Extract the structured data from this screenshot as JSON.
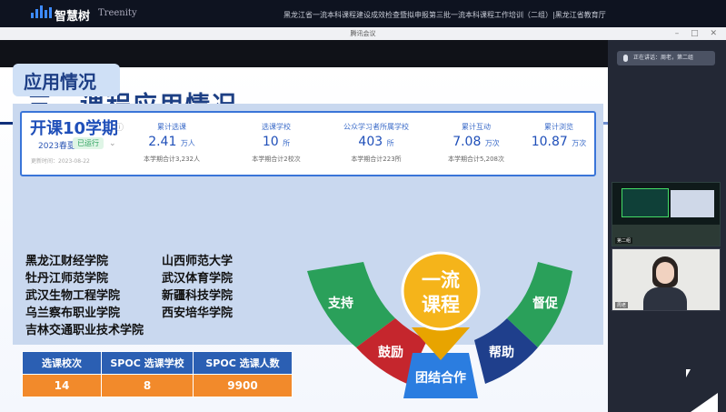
{
  "topbar": {
    "logo_text": "智慧树",
    "logo_brand": "Treenity",
    "title": "黑龙江省一流本科课程建设成效检查暨拟申报第三批一流本科课程工作培训（二组）|黑龙江省教育厅"
  },
  "window": {
    "title": "腾讯会议"
  },
  "slide": {
    "heading": "三、课程应用情况",
    "subheading": "应用情况",
    "course": {
      "title": "开课10学期",
      "semester": "2023春夏",
      "status": "已运行",
      "update_label": "更新时间：2023-08-22"
    },
    "stats": [
      {
        "label": "累计选课",
        "value": "2.41",
        "unit": "万人",
        "summary": "本学期合计3,232人"
      },
      {
        "label": "选课学校",
        "value": "10",
        "unit": "所",
        "summary": "本学期合计2校次"
      },
      {
        "label": "公众学习者所属学校",
        "value": "403",
        "unit": "所",
        "summary": "本学期合计223所"
      },
      {
        "label": "累计互动",
        "value": "7.08",
        "unit": "万次",
        "summary": "本学期合计5,208次"
      },
      {
        "label": "累计浏览",
        "value": "10.87",
        "unit": "万次",
        "summary": ""
      }
    ],
    "schools_left": [
      "黑龙江财经学院",
      "牡丹江师范学院",
      "武汉生物工程学院",
      "乌兰察布职业学院",
      "吉林交通职业技术学院"
    ],
    "schools_right": [
      "山西师范大学",
      "武汉体育学院",
      "新疆科技学院",
      "西安培华学院"
    ],
    "table": {
      "headers": [
        "选课校次",
        "SPOC 选课学校",
        "SPOC 选课人数"
      ],
      "values": [
        "14",
        "8",
        "9900"
      ]
    },
    "arc": {
      "center": "一流\n课程",
      "segments": [
        "支持",
        "鼓励",
        "团结合作",
        "帮助",
        "督促"
      ]
    }
  },
  "side": {
    "cam_top_label": "正在讲话：周老，第二组",
    "tile1_name": "第二组",
    "tile2_name": "周老"
  },
  "colors": {
    "accent": "#3a75d8",
    "orange": "#f28a2b",
    "green": "#2aa05a",
    "red": "#c5262d",
    "navy": "#1d3f84"
  }
}
